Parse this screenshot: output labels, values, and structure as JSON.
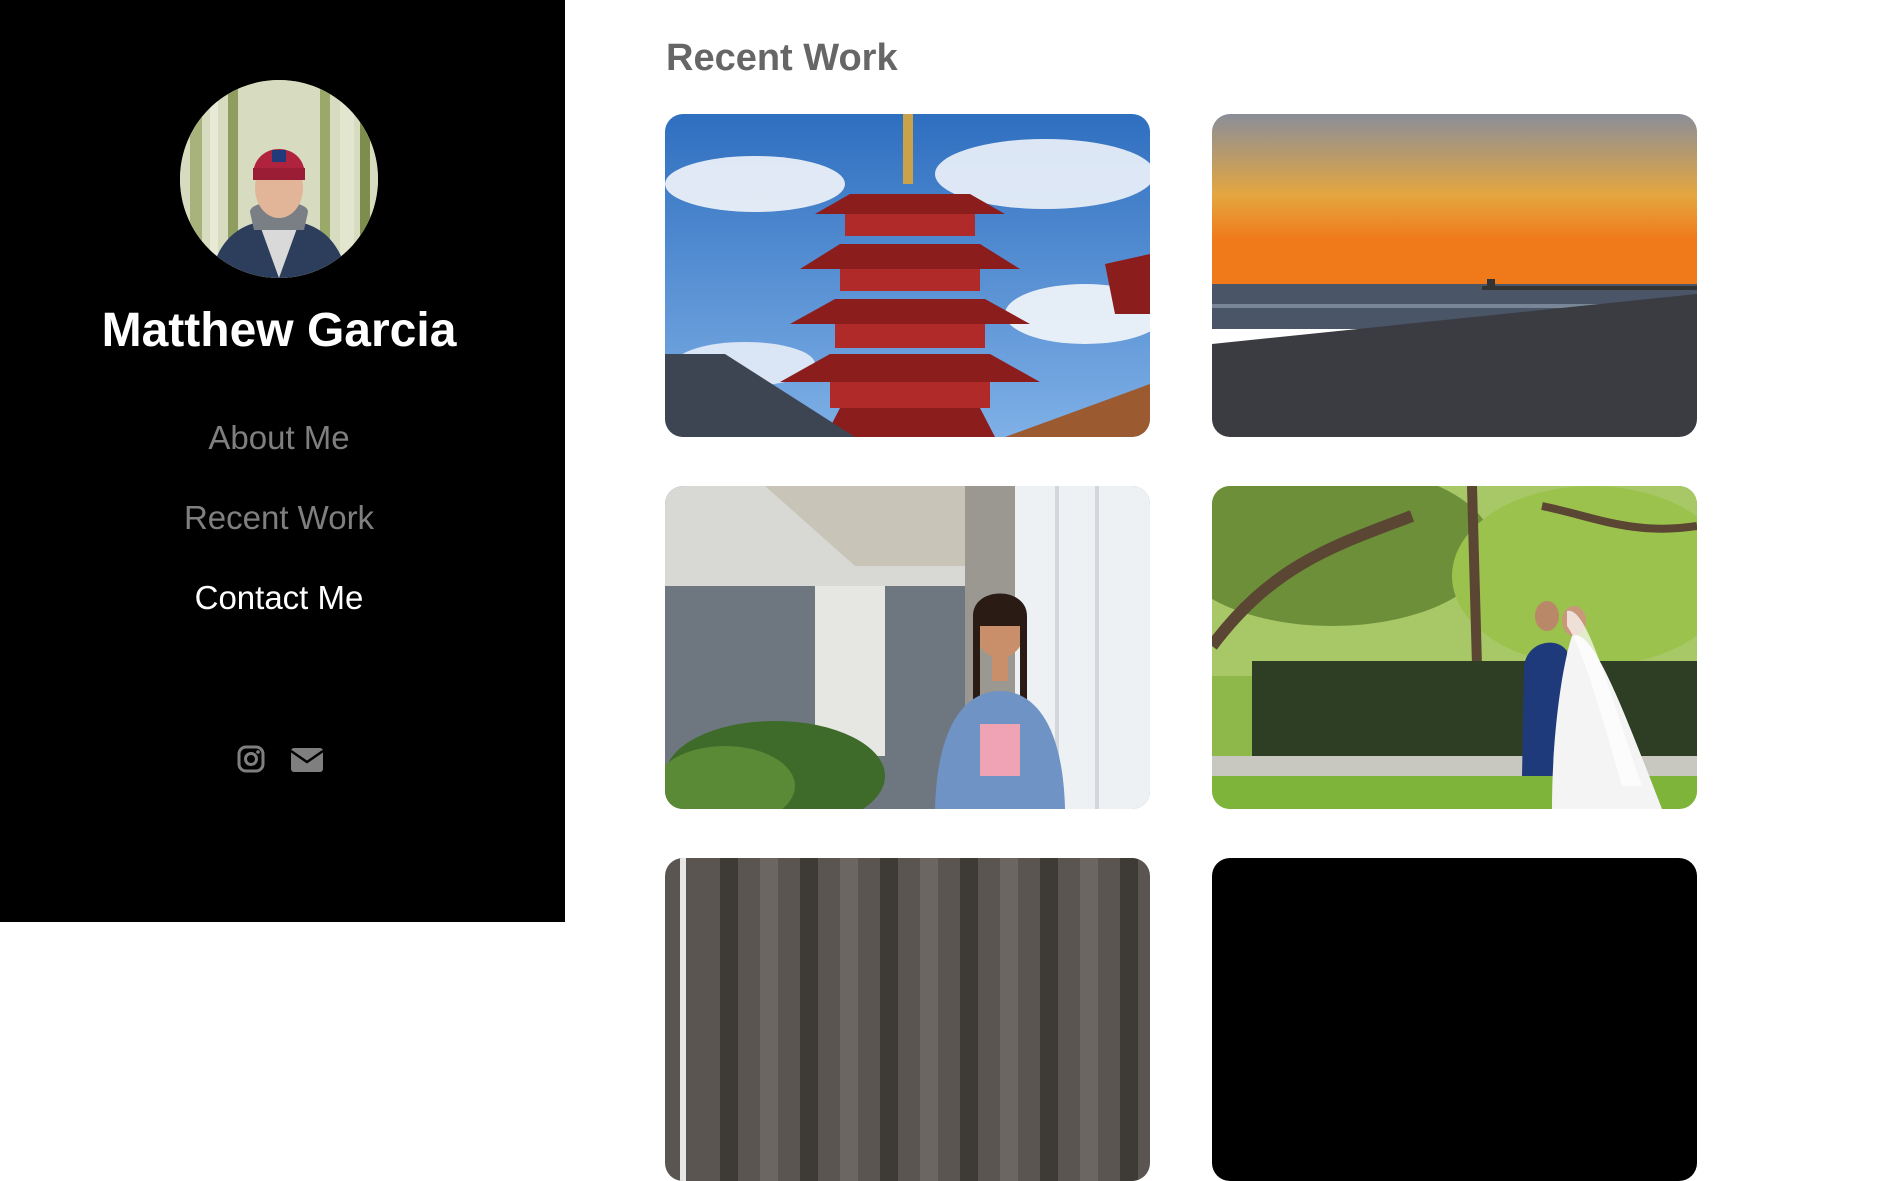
{
  "profile": {
    "name": "Matthew Garcia"
  },
  "nav": {
    "about": "About Me",
    "work": "Recent Work",
    "contact": "Contact Me"
  },
  "social": {
    "icons": [
      "instagram-icon",
      "envelope-icon"
    ]
  },
  "main": {
    "title": "Recent Work"
  },
  "gallery": [
    {
      "subject": "pagoda"
    },
    {
      "subject": "beach-sunset"
    },
    {
      "subject": "portrait-braids"
    },
    {
      "subject": "wedding-couple"
    },
    {
      "subject": "fence"
    },
    {
      "subject": "dark"
    }
  ],
  "colors": {
    "sidebar_bg": "#000000",
    "nav_inactive": "#7f7f7f",
    "nav_active": "#ffffff",
    "title": "#666666"
  }
}
